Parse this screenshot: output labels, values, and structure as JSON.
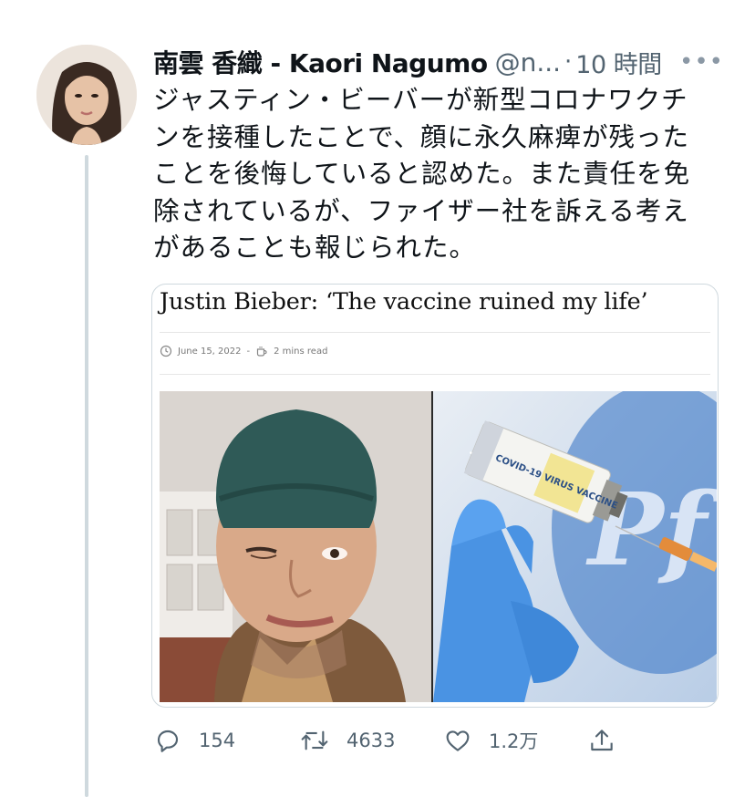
{
  "tweet": {
    "author_name": "南雲 香織 - Kaori Nagumo",
    "handle": "@n...",
    "separator": "·",
    "time": "10 時間",
    "more_label": "•••",
    "text": "ジャスティン・ビーバーが新型コロナワクチンを接種したことで、顔に永久麻痺が残ったことを後悔していると認めた。また責任を免除されているが、ファイザー社を訴える考えがあることも報じられた。"
  },
  "card": {
    "title": "Justin Bieber: ‘The vaccine ruined my life’",
    "date": "June 15, 2022",
    "meta_separator": "-",
    "read_time": "2 mins read",
    "vial_text": "COVID-19 VIRUS VACCINE"
  },
  "actions": {
    "replies": "154",
    "retweets": "4633",
    "likes": "1.2万"
  },
  "colors": {
    "text_primary": "#0f1419",
    "text_secondary": "#536471",
    "border": "#cfd9de",
    "glove_blue": "#4a93e3"
  },
  "icons": {
    "reply": "reply-icon",
    "retweet": "retweet-icon",
    "like": "heart-icon",
    "share": "share-icon",
    "more": "more-icon",
    "clock": "clock-icon",
    "cup": "coffee-cup-icon"
  }
}
